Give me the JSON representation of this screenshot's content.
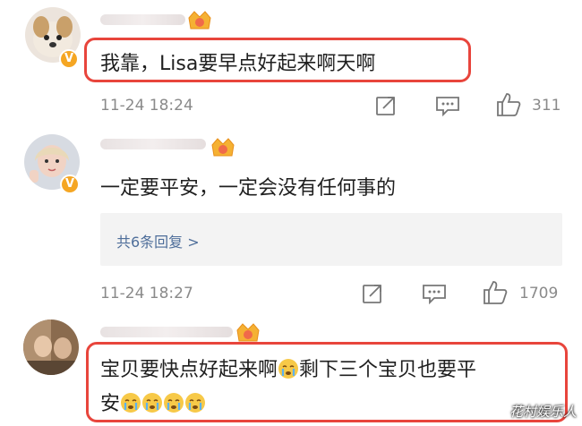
{
  "comments": [
    {
      "text": "我靠，Lisa要早点好起来啊天啊",
      "time": "11-24 18:24",
      "likes": "311"
    },
    {
      "text": "一定要平安，一定会没有任何事的",
      "replies_label": "共6条回复 >",
      "time": "11-24 18:27",
      "likes": "1709"
    },
    {
      "text_line1": "宝贝要快点好起来啊",
      "text_line1b": "剩下三个宝贝也要平",
      "text_line2": "安"
    }
  ],
  "watermark": "花村娱乐人",
  "colors": {
    "highlight": "#e8453c",
    "verified": "#f5a623",
    "link": "#4e6e9a"
  },
  "icons": [
    "share-icon",
    "comment-icon",
    "like-icon",
    "crying-emoji-icon",
    "crown-badge-icon"
  ]
}
